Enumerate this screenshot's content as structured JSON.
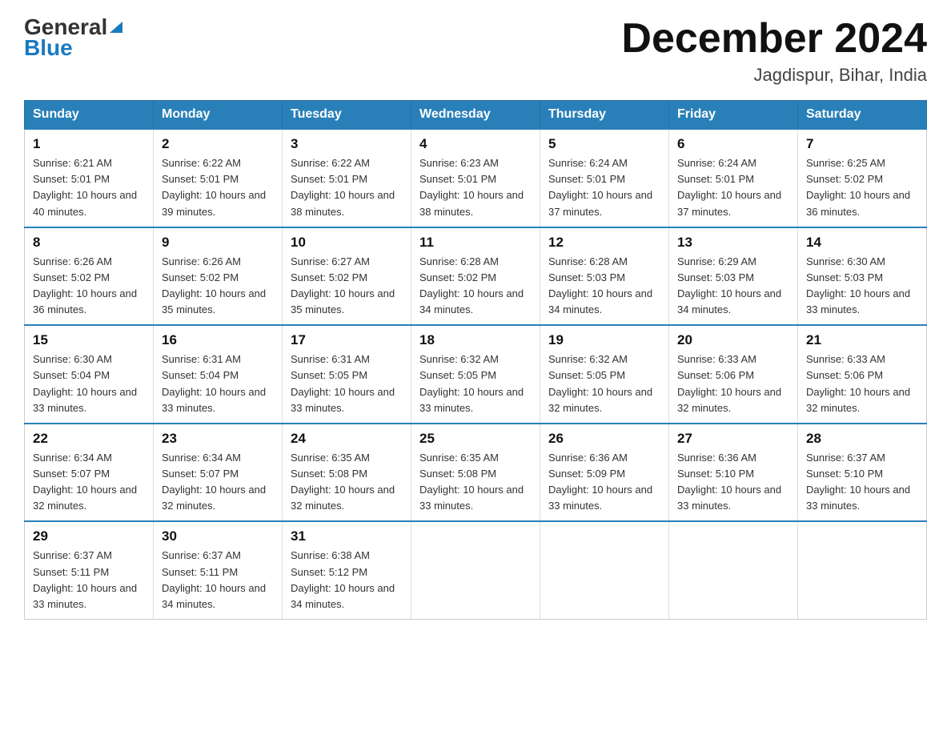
{
  "header": {
    "logo_general": "General",
    "logo_blue": "Blue",
    "month_title": "December 2024",
    "location": "Jagdispur, Bihar, India"
  },
  "weekdays": [
    "Sunday",
    "Monday",
    "Tuesday",
    "Wednesday",
    "Thursday",
    "Friday",
    "Saturday"
  ],
  "weeks": [
    [
      {
        "day": "1",
        "sunrise": "Sunrise: 6:21 AM",
        "sunset": "Sunset: 5:01 PM",
        "daylight": "Daylight: 10 hours and 40 minutes."
      },
      {
        "day": "2",
        "sunrise": "Sunrise: 6:22 AM",
        "sunset": "Sunset: 5:01 PM",
        "daylight": "Daylight: 10 hours and 39 minutes."
      },
      {
        "day": "3",
        "sunrise": "Sunrise: 6:22 AM",
        "sunset": "Sunset: 5:01 PM",
        "daylight": "Daylight: 10 hours and 38 minutes."
      },
      {
        "day": "4",
        "sunrise": "Sunrise: 6:23 AM",
        "sunset": "Sunset: 5:01 PM",
        "daylight": "Daylight: 10 hours and 38 minutes."
      },
      {
        "day": "5",
        "sunrise": "Sunrise: 6:24 AM",
        "sunset": "Sunset: 5:01 PM",
        "daylight": "Daylight: 10 hours and 37 minutes."
      },
      {
        "day": "6",
        "sunrise": "Sunrise: 6:24 AM",
        "sunset": "Sunset: 5:01 PM",
        "daylight": "Daylight: 10 hours and 37 minutes."
      },
      {
        "day": "7",
        "sunrise": "Sunrise: 6:25 AM",
        "sunset": "Sunset: 5:02 PM",
        "daylight": "Daylight: 10 hours and 36 minutes."
      }
    ],
    [
      {
        "day": "8",
        "sunrise": "Sunrise: 6:26 AM",
        "sunset": "Sunset: 5:02 PM",
        "daylight": "Daylight: 10 hours and 36 minutes."
      },
      {
        "day": "9",
        "sunrise": "Sunrise: 6:26 AM",
        "sunset": "Sunset: 5:02 PM",
        "daylight": "Daylight: 10 hours and 35 minutes."
      },
      {
        "day": "10",
        "sunrise": "Sunrise: 6:27 AM",
        "sunset": "Sunset: 5:02 PM",
        "daylight": "Daylight: 10 hours and 35 minutes."
      },
      {
        "day": "11",
        "sunrise": "Sunrise: 6:28 AM",
        "sunset": "Sunset: 5:02 PM",
        "daylight": "Daylight: 10 hours and 34 minutes."
      },
      {
        "day": "12",
        "sunrise": "Sunrise: 6:28 AM",
        "sunset": "Sunset: 5:03 PM",
        "daylight": "Daylight: 10 hours and 34 minutes."
      },
      {
        "day": "13",
        "sunrise": "Sunrise: 6:29 AM",
        "sunset": "Sunset: 5:03 PM",
        "daylight": "Daylight: 10 hours and 34 minutes."
      },
      {
        "day": "14",
        "sunrise": "Sunrise: 6:30 AM",
        "sunset": "Sunset: 5:03 PM",
        "daylight": "Daylight: 10 hours and 33 minutes."
      }
    ],
    [
      {
        "day": "15",
        "sunrise": "Sunrise: 6:30 AM",
        "sunset": "Sunset: 5:04 PM",
        "daylight": "Daylight: 10 hours and 33 minutes."
      },
      {
        "day": "16",
        "sunrise": "Sunrise: 6:31 AM",
        "sunset": "Sunset: 5:04 PM",
        "daylight": "Daylight: 10 hours and 33 minutes."
      },
      {
        "day": "17",
        "sunrise": "Sunrise: 6:31 AM",
        "sunset": "Sunset: 5:05 PM",
        "daylight": "Daylight: 10 hours and 33 minutes."
      },
      {
        "day": "18",
        "sunrise": "Sunrise: 6:32 AM",
        "sunset": "Sunset: 5:05 PM",
        "daylight": "Daylight: 10 hours and 33 minutes."
      },
      {
        "day": "19",
        "sunrise": "Sunrise: 6:32 AM",
        "sunset": "Sunset: 5:05 PM",
        "daylight": "Daylight: 10 hours and 32 minutes."
      },
      {
        "day": "20",
        "sunrise": "Sunrise: 6:33 AM",
        "sunset": "Sunset: 5:06 PM",
        "daylight": "Daylight: 10 hours and 32 minutes."
      },
      {
        "day": "21",
        "sunrise": "Sunrise: 6:33 AM",
        "sunset": "Sunset: 5:06 PM",
        "daylight": "Daylight: 10 hours and 32 minutes."
      }
    ],
    [
      {
        "day": "22",
        "sunrise": "Sunrise: 6:34 AM",
        "sunset": "Sunset: 5:07 PM",
        "daylight": "Daylight: 10 hours and 32 minutes."
      },
      {
        "day": "23",
        "sunrise": "Sunrise: 6:34 AM",
        "sunset": "Sunset: 5:07 PM",
        "daylight": "Daylight: 10 hours and 32 minutes."
      },
      {
        "day": "24",
        "sunrise": "Sunrise: 6:35 AM",
        "sunset": "Sunset: 5:08 PM",
        "daylight": "Daylight: 10 hours and 32 minutes."
      },
      {
        "day": "25",
        "sunrise": "Sunrise: 6:35 AM",
        "sunset": "Sunset: 5:08 PM",
        "daylight": "Daylight: 10 hours and 33 minutes."
      },
      {
        "day": "26",
        "sunrise": "Sunrise: 6:36 AM",
        "sunset": "Sunset: 5:09 PM",
        "daylight": "Daylight: 10 hours and 33 minutes."
      },
      {
        "day": "27",
        "sunrise": "Sunrise: 6:36 AM",
        "sunset": "Sunset: 5:10 PM",
        "daylight": "Daylight: 10 hours and 33 minutes."
      },
      {
        "day": "28",
        "sunrise": "Sunrise: 6:37 AM",
        "sunset": "Sunset: 5:10 PM",
        "daylight": "Daylight: 10 hours and 33 minutes."
      }
    ],
    [
      {
        "day": "29",
        "sunrise": "Sunrise: 6:37 AM",
        "sunset": "Sunset: 5:11 PM",
        "daylight": "Daylight: 10 hours and 33 minutes."
      },
      {
        "day": "30",
        "sunrise": "Sunrise: 6:37 AM",
        "sunset": "Sunset: 5:11 PM",
        "daylight": "Daylight: 10 hours and 34 minutes."
      },
      {
        "day": "31",
        "sunrise": "Sunrise: 6:38 AM",
        "sunset": "Sunset: 5:12 PM",
        "daylight": "Daylight: 10 hours and 34 minutes."
      },
      null,
      null,
      null,
      null
    ]
  ]
}
